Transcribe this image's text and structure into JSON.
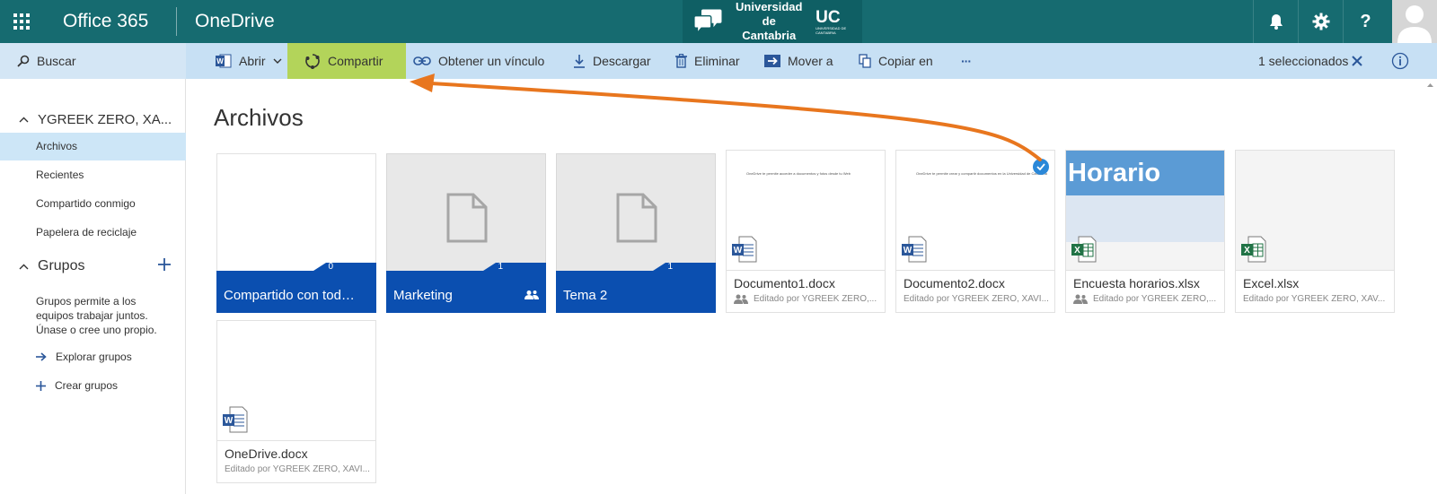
{
  "suite": {
    "brand": "Office 365",
    "app": "OneDrive",
    "university_line1": "Universidad de",
    "university_line2": "Cantabria",
    "university_mark": "UC",
    "university_mark_small": "UNIVERSIDAD DE CANTABRIA",
    "help_label": "?"
  },
  "toolbar": {
    "search": "Buscar",
    "open": "Abrir",
    "share": "Compartir",
    "get_link": "Obtener un vínculo",
    "download": "Descargar",
    "delete": "Eliminar",
    "move_to": "Mover a",
    "copy_to": "Copiar en",
    "more": "···",
    "selected_count": "1 seleccionados"
  },
  "nav": {
    "user": "YGREEK ZERO, XA...",
    "items": [
      {
        "label": "Archivos",
        "active": true
      },
      {
        "label": "Recientes",
        "active": false
      },
      {
        "label": "Compartido conmigo",
        "active": false
      },
      {
        "label": "Papelera de reciclaje",
        "active": false
      }
    ],
    "groups_title": "Grupos",
    "groups_description": "Grupos permite a los equipos trabajar juntos. Únase o cree uno propio.",
    "explore_groups": "Explorar grupos",
    "create_groups": "Crear grupos"
  },
  "main": {
    "title": "Archivos",
    "folders": [
      {
        "name": "Compartido con todos ...",
        "count": "0",
        "shared": false,
        "empty": true
      },
      {
        "name": "Marketing",
        "count": "1",
        "shared": true,
        "empty": false
      },
      {
        "name": "Tema 2",
        "count": "1",
        "shared": false,
        "empty": false
      }
    ],
    "files": [
      {
        "name": "Documento1.docx",
        "meta": "Editado por YGREEK ZERO,...",
        "type": "word",
        "shared": true,
        "selected": false,
        "preview_text": "OneDrive te permite acceder a documentos y fotos desde tu Web"
      },
      {
        "name": "Documento2.docx",
        "meta": "Editado por YGREEK ZERO, XAVI...",
        "type": "word",
        "shared": false,
        "selected": true,
        "preview_text": "OneDrive te permite crear y compartir documentos en la Universidad de Cantabria"
      },
      {
        "name": "Encuesta horarios.xlsx",
        "meta": "Editado por YGREEK ZERO,...",
        "type": "excel",
        "shared": true,
        "selected": false,
        "preview_text": "Horario"
      },
      {
        "name": "Excel.xlsx",
        "meta": "Editado por YGREEK ZERO, XAV...",
        "type": "excel",
        "shared": false,
        "selected": false,
        "preview_text": ""
      },
      {
        "name": "OneDrive.docx",
        "meta": "Editado por YGREEK ZERO, XAVI...",
        "type": "word",
        "shared": false,
        "selected": false,
        "preview_text": ""
      }
    ]
  },
  "colors": {
    "suite_bar": "#166b70",
    "command_bar": "#c7e0f4",
    "share_highlight": "#b3d45a",
    "folder_blue": "#0b4fb0",
    "annotation_arrow": "#e8761e",
    "selection_check": "#2b88d8"
  }
}
